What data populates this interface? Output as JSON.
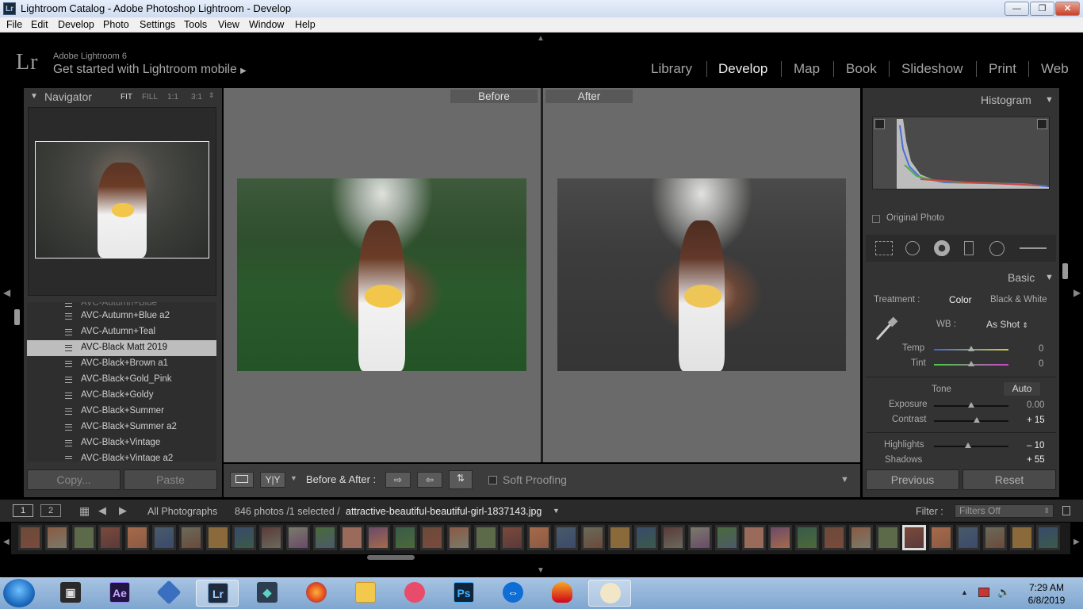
{
  "window": {
    "title": "Lightroom Catalog - Adobe Photoshop Lightroom - Develop",
    "app_icon": "Lr",
    "min": "—",
    "max": "❐",
    "close": "✕"
  },
  "menu": [
    "File",
    "Edit",
    "Develop",
    "Photo",
    "Settings",
    "Tools",
    "View",
    "Window",
    "Help"
  ],
  "identity": {
    "logo": "Lr",
    "product": "Adobe Lightroom 6",
    "tagline": "Get started with Lightroom mobile"
  },
  "modules": [
    "Library",
    "Develop",
    "Map",
    "Book",
    "Slideshow",
    "Print",
    "Web"
  ],
  "active_module": "Develop",
  "navigator": {
    "title": "Navigator",
    "zoom": [
      "FIT",
      "FILL",
      "1:1",
      "3:1"
    ]
  },
  "presets": {
    "items": [
      "AVC-Autumn+Blue a2",
      "AVC-Autumn+Teal",
      "AVC-Black Matt 2019",
      "AVC-Black+Brown a1",
      "AVC-Black+Gold_Pink",
      "AVC-Black+Goldy",
      "AVC-Black+Summer",
      "AVC-Black+Summer a2",
      "AVC-Black+Vintage",
      "AVC-Black+Vintage a2"
    ],
    "selected_index": 2
  },
  "left_buttons": {
    "copy": "Copy...",
    "paste": "Paste"
  },
  "compare": {
    "before": "Before",
    "after": "After"
  },
  "toolbar": {
    "before_after": "Before & After :",
    "soft_proofing": "Soft Proofing",
    "yy": "Y|Y"
  },
  "histogram": {
    "title": "Histogram",
    "original_photo": "Original Photo"
  },
  "basic": {
    "title": "Basic",
    "treatment_label": "Treatment :",
    "color": "Color",
    "bw": "Black & White",
    "wb_label": "WB :",
    "wb_value": "As Shot",
    "temp_label": "Temp",
    "temp_value": "0",
    "tint_label": "Tint",
    "tint_value": "0",
    "tone_label": "Tone",
    "auto": "Auto",
    "exposure_label": "Exposure",
    "exposure_value": "0.00",
    "contrast_label": "Contrast",
    "contrast_value": "+ 15",
    "highlights_label": "Highlights",
    "highlights_value": "– 10",
    "shadows_label": "Shadows",
    "shadows_value": "+ 55"
  },
  "right_buttons": {
    "previous": "Previous",
    "reset": "Reset"
  },
  "filmbar": {
    "view1": "1",
    "view2": "2",
    "source": "All Photographs",
    "count": "846 photos /1 selected /",
    "filename": "attractive-beautiful-beautiful-girl-1837143.jpg",
    "filter_label": "Filter :",
    "filter_value": "Filters Off"
  },
  "taskbar": {
    "time": "7:29 AM",
    "date": "6/8/2019",
    "apps": [
      "Ae",
      "Lr",
      "Ps"
    ]
  }
}
